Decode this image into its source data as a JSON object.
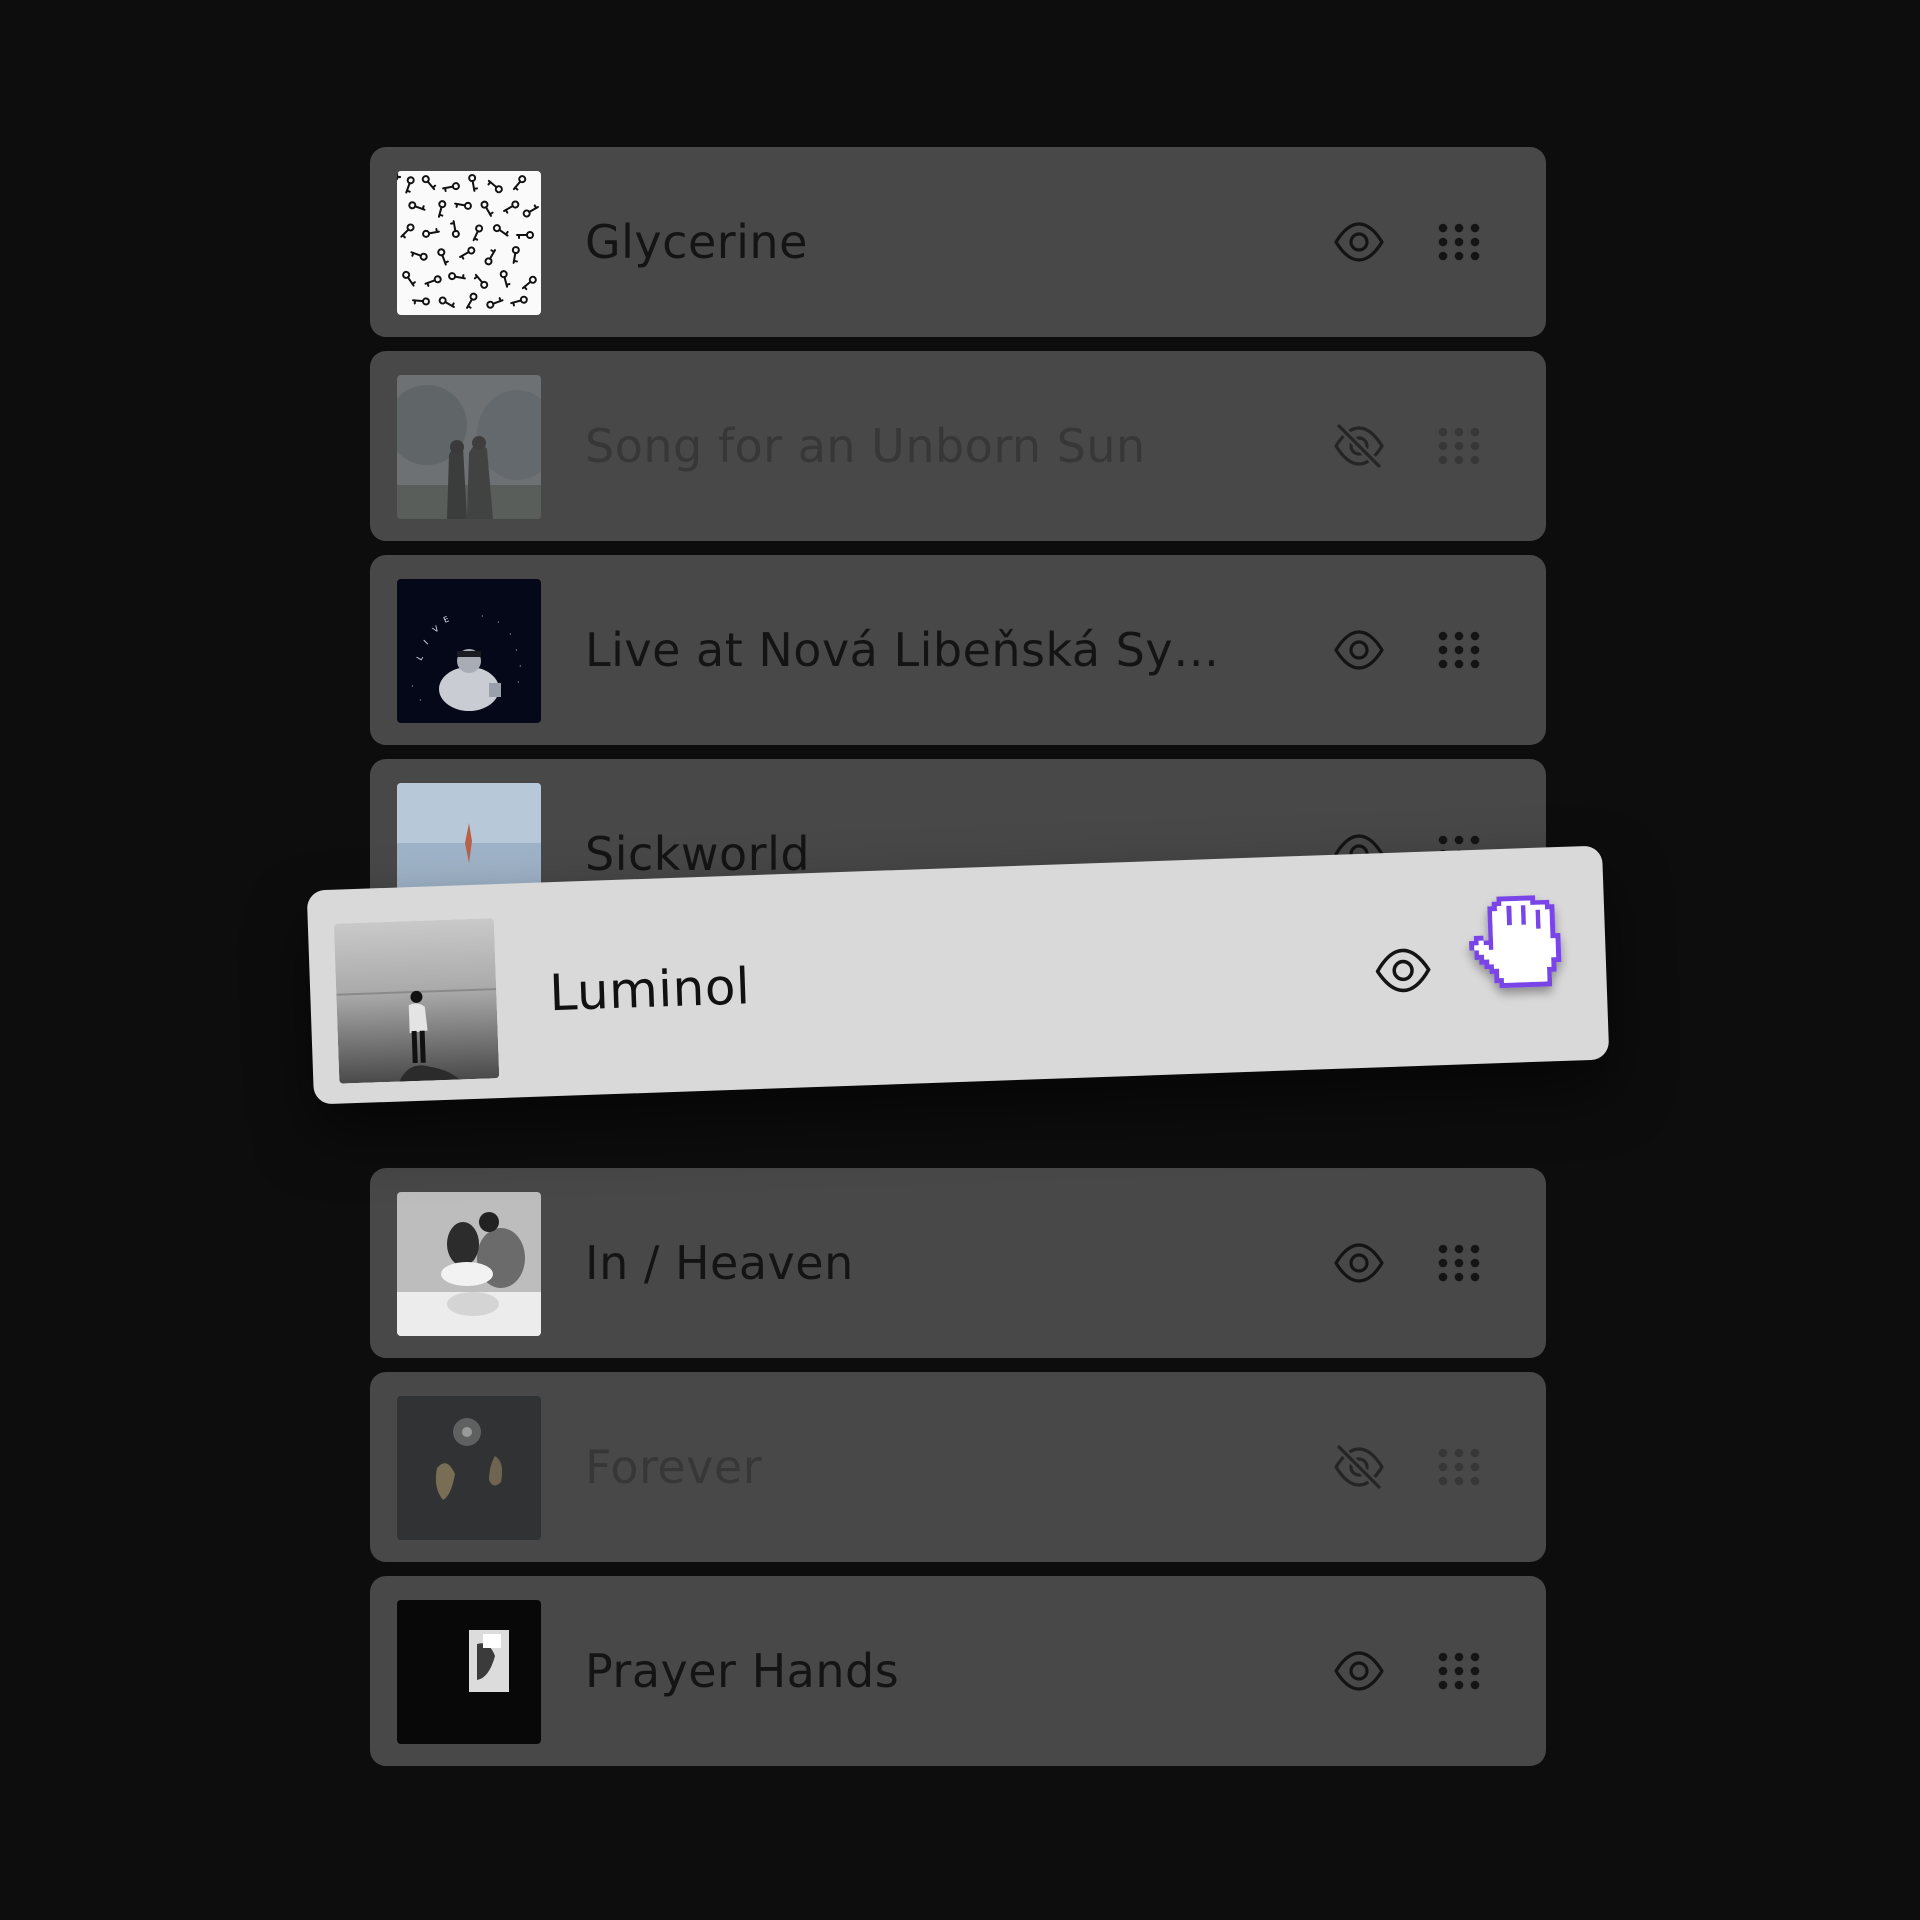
{
  "tracks": [
    {
      "title": "Glycerine",
      "visible": true,
      "eye_icon": "eye-icon",
      "thumb": "keys-pattern"
    },
    {
      "title": "Song for an Unborn Sun",
      "visible": false,
      "eye_icon": "eye-off-icon",
      "thumb": "figures-forest"
    },
    {
      "title": "Live at Nová Libeňská Sy…",
      "visible": true,
      "eye_icon": "eye-icon",
      "thumb": "live-performer"
    },
    {
      "title": "Sickworld",
      "visible": true,
      "eye_icon": "eye-icon",
      "thumb": "sky-figure"
    },
    {
      "title": "In / Heaven",
      "visible": true,
      "eye_icon": "eye-icon",
      "thumb": "couple-bw"
    },
    {
      "title": "Forever",
      "visible": false,
      "eye_icon": "eye-off-icon",
      "thumb": "dark-light"
    },
    {
      "title": "Prayer Hands",
      "visible": true,
      "eye_icon": "eye-icon",
      "thumb": "dark-portrait"
    }
  ],
  "dragging": {
    "title": "Luminol",
    "visible": true,
    "eye_icon": "eye-icon",
    "cursor_icon": "grab-hand-icon"
  },
  "colors": {
    "background": "#0d0d0e",
    "row": "#484848",
    "drag_row": "#d9d9da",
    "cursor_accent": "#7a45e8"
  }
}
